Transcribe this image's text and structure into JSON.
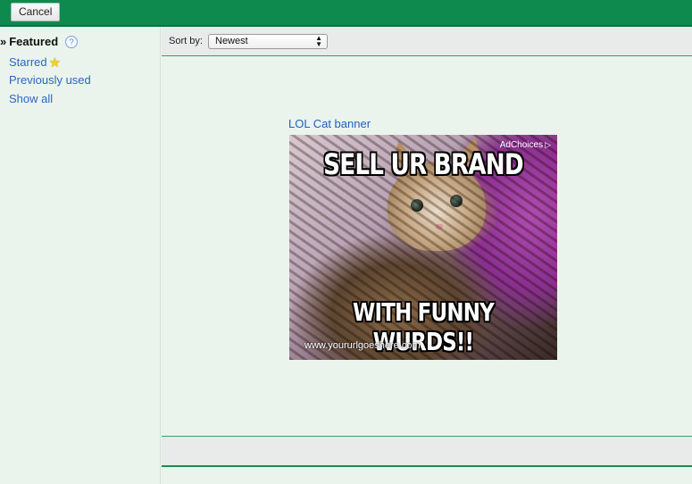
{
  "toolbar": {
    "cancel_label": "Cancel"
  },
  "sidebar": {
    "featured": {
      "chevron": "»",
      "label": "Featured",
      "help_glyph": "?"
    },
    "items": [
      {
        "label": "Starred",
        "icon": "star-icon"
      },
      {
        "label": "Previously used"
      },
      {
        "label": "Show all"
      }
    ]
  },
  "sort": {
    "label": "Sort by:",
    "selected": "Newest"
  },
  "ad": {
    "title": "LOL Cat banner",
    "adchoices": "AdChoices",
    "top_text": "SELL UR BRAND",
    "bottom_text": "WITH FUNNY WURDS!!",
    "url": "www.yoururlgoeshere.com"
  },
  "colors": {
    "header": "#0e8a4f",
    "panel": "#eaf4ec",
    "link": "#2a66c4"
  }
}
